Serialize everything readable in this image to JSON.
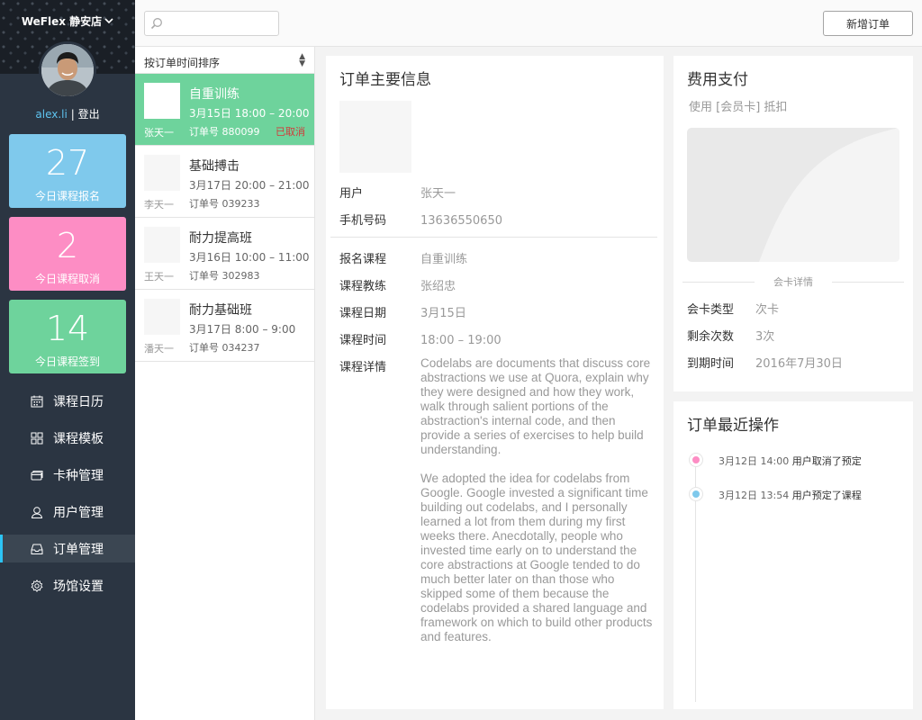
{
  "store": {
    "name": "WeFlex 静安店"
  },
  "user": {
    "name": "alex.li",
    "separator": "|",
    "logout": "登出"
  },
  "stats": [
    {
      "value": "27",
      "label": "今日课程报名",
      "color": "#7fc9ec"
    },
    {
      "value": "2",
      "label": "今日课程取消",
      "color": "#fd8dc4"
    },
    {
      "value": "14",
      "label": "今日课程签到",
      "color": "#6ed39c"
    }
  ],
  "nav": [
    {
      "label": "课程日历",
      "icon": "calendar-icon"
    },
    {
      "label": "课程模板",
      "icon": "grid-icon"
    },
    {
      "label": "卡种管理",
      "icon": "card-icon"
    },
    {
      "label": "用户管理",
      "icon": "user-icon"
    },
    {
      "label": "订单管理",
      "icon": "inbox-icon",
      "active": true
    },
    {
      "label": "场馆设置",
      "icon": "gear-icon"
    }
  ],
  "search": {
    "placeholder": "",
    "value": ""
  },
  "toolbar": {
    "new_order": "新增订单"
  },
  "sort": {
    "label": "按订单时间排序"
  },
  "orders": [
    {
      "title": "自重训练",
      "time": "3月15日 18:00 – 20:00",
      "number": "订单号 880099",
      "user": "张天一",
      "status": "已取消",
      "active": true
    },
    {
      "title": "基础搏击",
      "time": "3月17日 20:00 – 21:00",
      "number": "订单号 039233",
      "user": "李天一",
      "status": ""
    },
    {
      "title": "耐力提高班",
      "time": "3月16日 10:00 – 11:00",
      "number": "订单号 302983",
      "user": "王天一",
      "status": ""
    },
    {
      "title": "耐力基础班",
      "time": "3月17日 8:00 – 9:00",
      "number": "订单号 034237",
      "user": "潘天一",
      "status": ""
    }
  ],
  "main": {
    "title": "订单主要信息",
    "user_label": "用户",
    "user_value": "张天一",
    "phone_label": "手机号码",
    "phone_value": "13636550650",
    "course_label": "报名课程",
    "course_value": "自重训练",
    "coach_label": "课程教练",
    "coach_value": "张绍忠",
    "date_label": "课程日期",
    "date_value": "3月15日",
    "time_label": "课程时间",
    "time_value": "18:00 – 19:00",
    "detail_label": "课程详情",
    "detail_p1": "Codelabs are documents that discuss core abstractions we use at Quora, explain why they were designed and how they work, walk through salient portions of the abstraction's internal code, and then provide a series of exercises to help build understanding.",
    "detail_p2": "We adopted the idea for codelabs from Google.  Google invested a significant time building out codelabs, and I personally learned a lot from them during my first weeks there.  Anecdotally, people who invested time early on to understand the core abstractions at Google tended to do much better later on than those who skipped some of them because the codelabs provided a shared language and framework on which to build other products and features."
  },
  "payment": {
    "title": "费用支付",
    "subtitle": "使用 [会员卡] 抵扣",
    "card_details_label": "会卡详情",
    "type_label": "会卡类型",
    "type_value": "次卡",
    "remaining_label": "剩余次数",
    "remaining_value": "3次",
    "expiry_label": "到期时间",
    "expiry_value": "2016年7月30日"
  },
  "recent": {
    "title": "订单最近操作",
    "ops": [
      {
        "time": "3月12日 14:00",
        "text": "用户取消了预定",
        "color": "pink"
      },
      {
        "time": "3月12日 13:54",
        "text": "用户预定了课程",
        "color": "blue"
      }
    ]
  }
}
